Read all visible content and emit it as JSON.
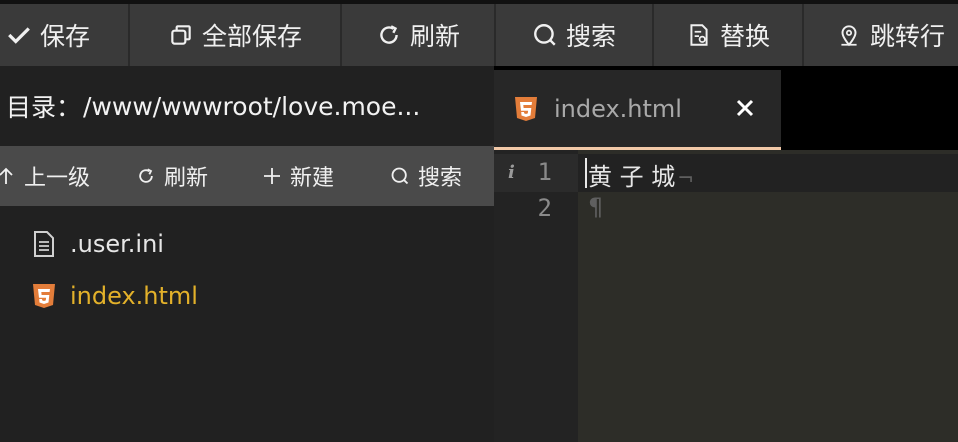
{
  "toolbar": {
    "items": [
      {
        "label": "保存",
        "icon": "check-icon"
      },
      {
        "label": "全部保存",
        "icon": "copy-icon"
      },
      {
        "label": "刷新",
        "icon": "refresh-icon"
      },
      {
        "label": "搜索",
        "icon": "search-icon"
      },
      {
        "label": "替换",
        "icon": "replace-icon"
      },
      {
        "label": "跳转行",
        "icon": "location-pin-icon"
      }
    ]
  },
  "sidebar": {
    "path_label": "目录：",
    "path_value": "/www/wwwroot/love.moe...",
    "actions": [
      {
        "label": "上一级",
        "icon": "arrow-up-icon"
      },
      {
        "label": "刷新",
        "icon": "refresh-icon"
      },
      {
        "label": "新建",
        "icon": "plus-icon"
      },
      {
        "label": "搜索",
        "icon": "search-icon"
      }
    ],
    "files": [
      {
        "name": ".user.ini",
        "icon": "document-icon",
        "active": false
      },
      {
        "name": "index.html",
        "icon": "html5-icon",
        "active": true
      }
    ]
  },
  "editor": {
    "tab": {
      "title": "index.html",
      "icon": "html5-icon",
      "close": "✕"
    },
    "line_numbers": [
      "1",
      "2"
    ],
    "lines": [
      "黄 子 城",
      ""
    ],
    "eol_marker": "¬",
    "empty_marker": "¶",
    "gutter_info": "i"
  },
  "colors": {
    "active_file": "#e3b12a",
    "html5": "#e37d3a",
    "tab_underline": "#f2c9a8"
  }
}
